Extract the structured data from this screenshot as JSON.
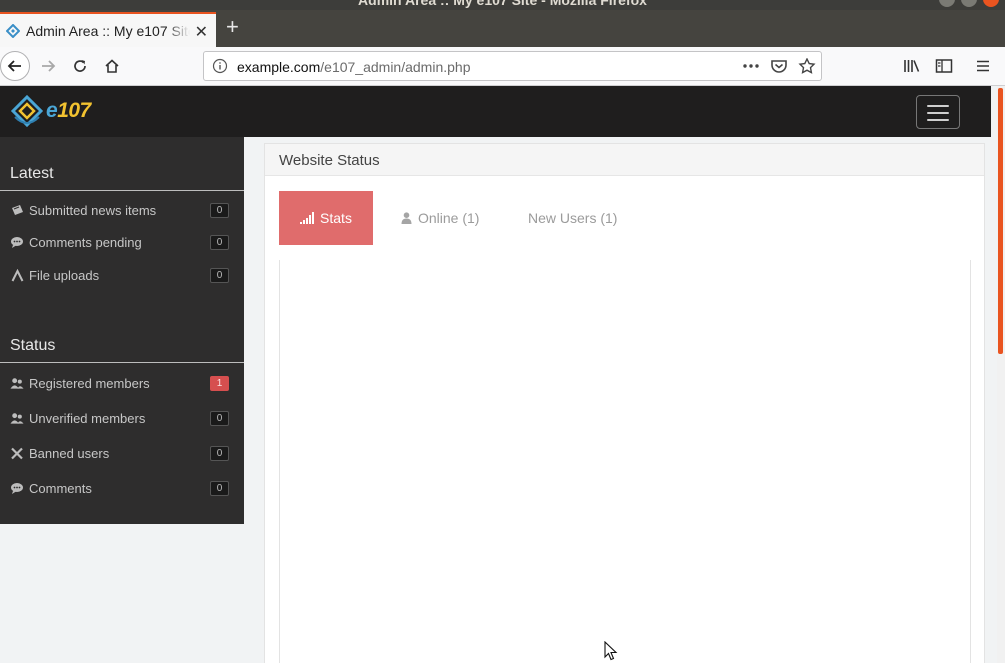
{
  "window": {
    "title": "Admin Area :: My e107 Site - Mozilla Firefox"
  },
  "browser": {
    "tab_title": "Admin Area :: My e107 Site",
    "url_host": "example.com",
    "url_path": "/e107_admin/admin.php"
  },
  "header": {
    "logo_main": "e",
    "logo_accent": "107"
  },
  "sidebar": {
    "latest_title": "Latest",
    "latest_items": [
      {
        "label": "Submitted news items",
        "count": "0"
      },
      {
        "label": "Comments pending",
        "count": "0"
      },
      {
        "label": "File uploads",
        "count": "0"
      }
    ],
    "status_title": "Status",
    "status_items": [
      {
        "label": "Registered members",
        "count": "1"
      },
      {
        "label": "Unverified members",
        "count": "0"
      },
      {
        "label": "Banned users",
        "count": "0"
      },
      {
        "label": "Comments",
        "count": "0"
      }
    ]
  },
  "panel": {
    "title": "Website Status",
    "tabs": [
      {
        "label": "Stats",
        "active": true
      },
      {
        "label": "Online (1)",
        "active": false
      },
      {
        "label": "New Users (1)",
        "active": false
      }
    ]
  },
  "colors": {
    "accent_orange": "#e95420",
    "tab_active": "#e06c6c",
    "badge_alert": "#d64f4f",
    "sidebar_bg": "#2e2d2d",
    "header_bg": "#1f1e1e"
  }
}
